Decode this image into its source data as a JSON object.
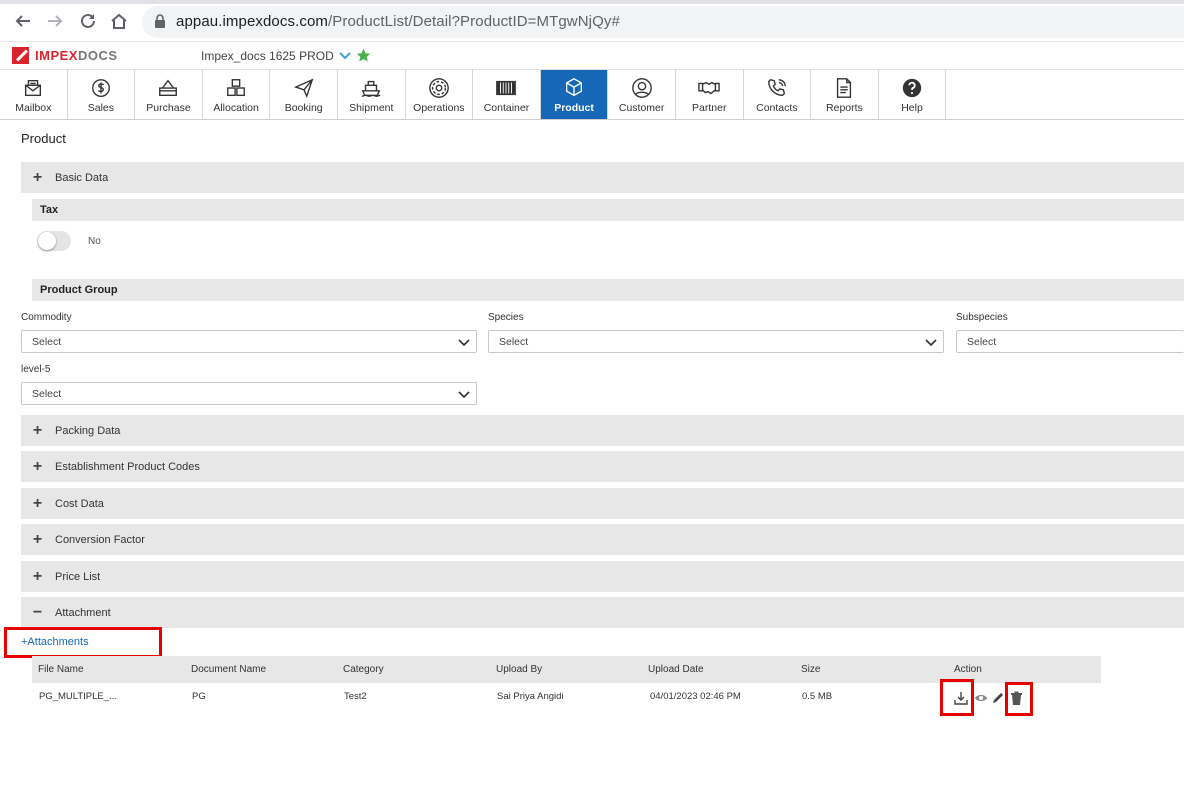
{
  "browser": {
    "url_host": "appau.impexdocs.com",
    "url_path": "/ProductList/Detail?ProductID=MTgwNjQy#"
  },
  "header": {
    "logo_part1": "IMPEX",
    "logo_part2": "DOCS",
    "environment": "Impex_docs 1625 PROD"
  },
  "modules": [
    {
      "label": "Mailbox",
      "icon": "mailbox-icon"
    },
    {
      "label": "Sales",
      "icon": "dollar-icon"
    },
    {
      "label": "Purchase",
      "icon": "card-icon"
    },
    {
      "label": "Allocation",
      "icon": "boxes-icon"
    },
    {
      "label": "Booking",
      "icon": "paper-plane-icon"
    },
    {
      "label": "Shipment",
      "icon": "ship-icon"
    },
    {
      "label": "Operations",
      "icon": "gear-icon"
    },
    {
      "label": "Container",
      "icon": "container-icon"
    },
    {
      "label": "Product",
      "icon": "cube-icon",
      "active": true
    },
    {
      "label": "Customer",
      "icon": "user-icon"
    },
    {
      "label": "Partner",
      "icon": "handshake-icon"
    },
    {
      "label": "Contacts",
      "icon": "phone-icon"
    },
    {
      "label": "Reports",
      "icon": "report-icon"
    },
    {
      "label": "Help",
      "icon": "help-icon"
    }
  ],
  "page": {
    "title": "Product",
    "basic_data": "Basic Data",
    "tax": "Tax",
    "tax_toggle": "No",
    "product_group": "Product Group",
    "commodity_label": "Commodity",
    "commodity_value": "Select",
    "species_label": "Species",
    "species_value": "Select",
    "subspecies_label": "Subspecies",
    "subspecies_value": "Select",
    "level5_label": "level-5",
    "level5_value": "Select",
    "sections": [
      "Packing Data",
      "Establishment Product Codes",
      "Cost Data",
      "Conversion Factor",
      "Price List"
    ],
    "attachment": "Attachment",
    "add_attachments": "+Attachments"
  },
  "table": {
    "headers": [
      "File Name",
      "Document Name",
      "Category",
      "Upload By",
      "Upload Date",
      "Size",
      "Action"
    ],
    "row": [
      "PG_MULTIPLE_...",
      "PG",
      "Test2",
      "Sai Priya Angidi",
      "04/01/2023 02:46 PM",
      "0.5 MB"
    ]
  },
  "colors": {
    "active_module": "#1667b5",
    "highlight_red": "#e60000",
    "brand_red": "#d9232d"
  }
}
